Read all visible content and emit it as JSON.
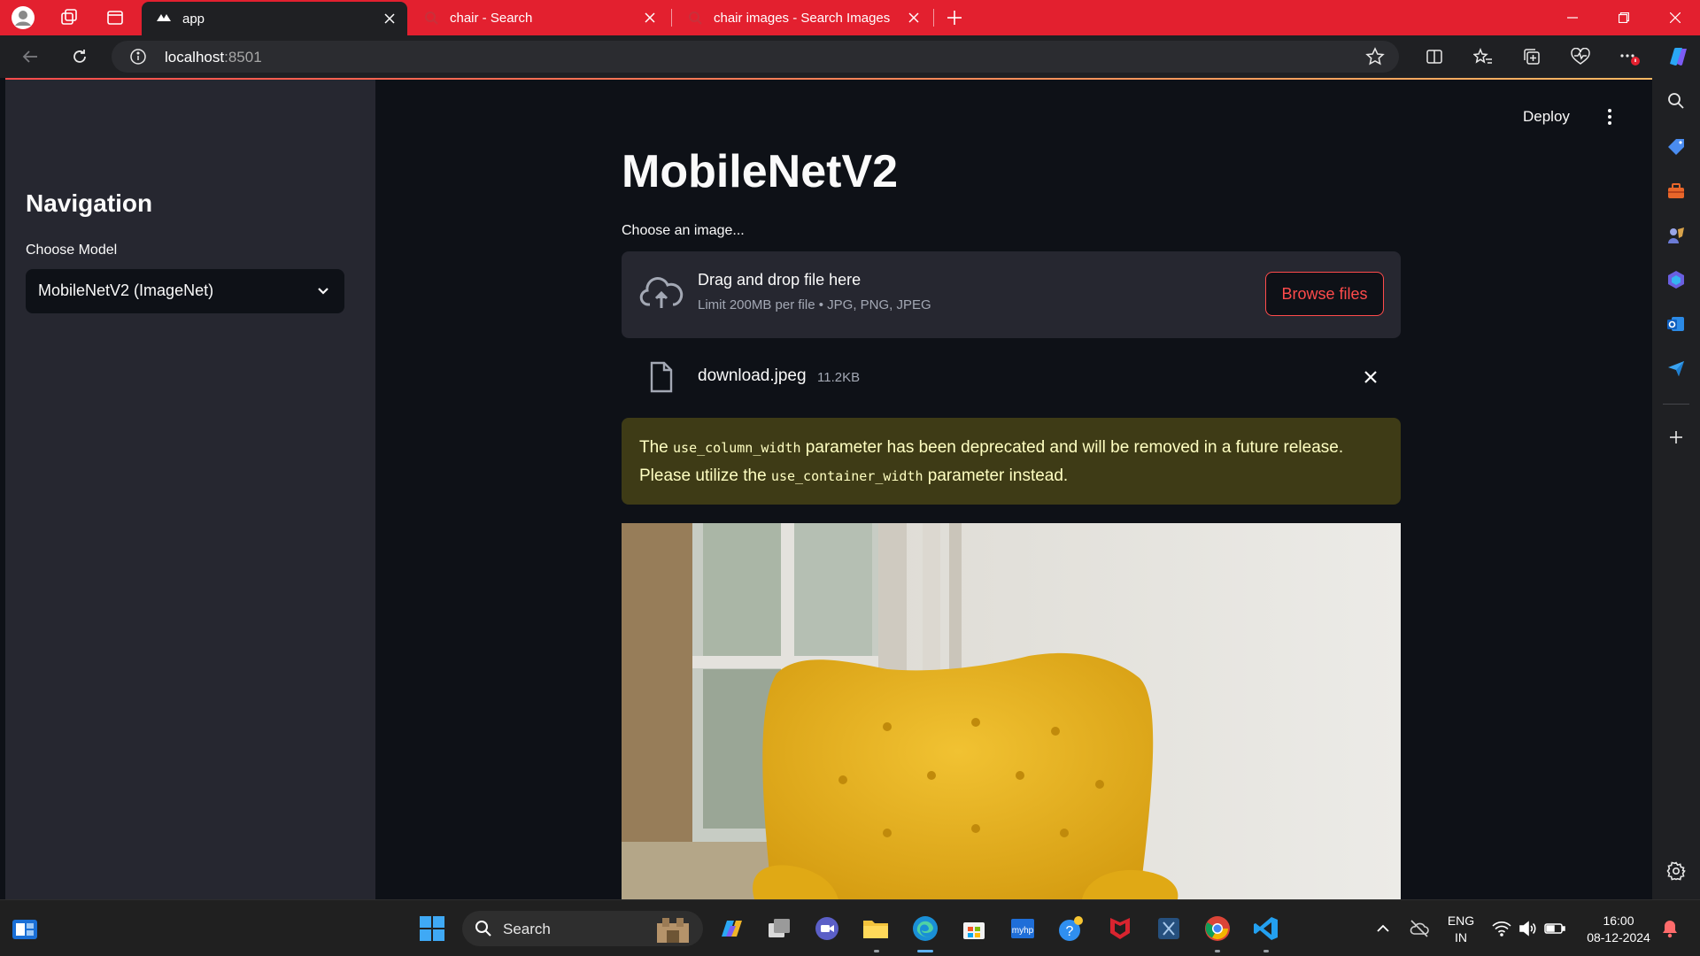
{
  "browser": {
    "tabs": [
      {
        "title": "app",
        "active": true
      },
      {
        "title": "chair - Search",
        "active": false
      },
      {
        "title": "chair images - Search Images",
        "active": false
      }
    ],
    "address": {
      "host": "localhost",
      "port": ":8501"
    }
  },
  "sidebar": {
    "heading": "Navigation",
    "model_label": "Choose Model",
    "model_value": "MobileNetV2 (ImageNet)"
  },
  "header": {
    "deploy_label": "Deploy"
  },
  "main": {
    "title": "MobileNetV2",
    "uploader_label": "Choose an image...",
    "dropzone_title": "Drag and drop file here",
    "dropzone_limit": "Limit 200MB per file • JPG, PNG, JPEG",
    "browse_label": "Browse files",
    "file_name": "download.jpeg",
    "file_size": "11.2KB",
    "warning": {
      "text_1": "The ",
      "code_1": "use_column_width",
      "text_2": " parameter has been deprecated and will be removed in a future release. Please utilize the ",
      "code_2": "use_container_width",
      "text_3": " parameter instead."
    }
  },
  "taskbar": {
    "search_placeholder": "Search",
    "lang_1": "ENG",
    "lang_2": "IN",
    "time": "16:00",
    "date": "08-12-2024"
  },
  "colors": {
    "accent": "#ff4b4b",
    "tab_strip": "#e3202f",
    "warning_bg": "#3e3b16",
    "warning_text": "#ffffc2"
  }
}
